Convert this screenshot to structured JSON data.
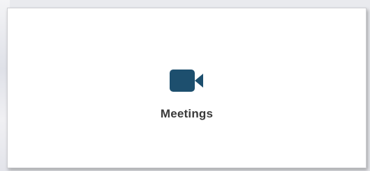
{
  "tile": {
    "label": "Meetings",
    "icon": "video-camera-icon",
    "icon_color": "#1d4f6e"
  }
}
